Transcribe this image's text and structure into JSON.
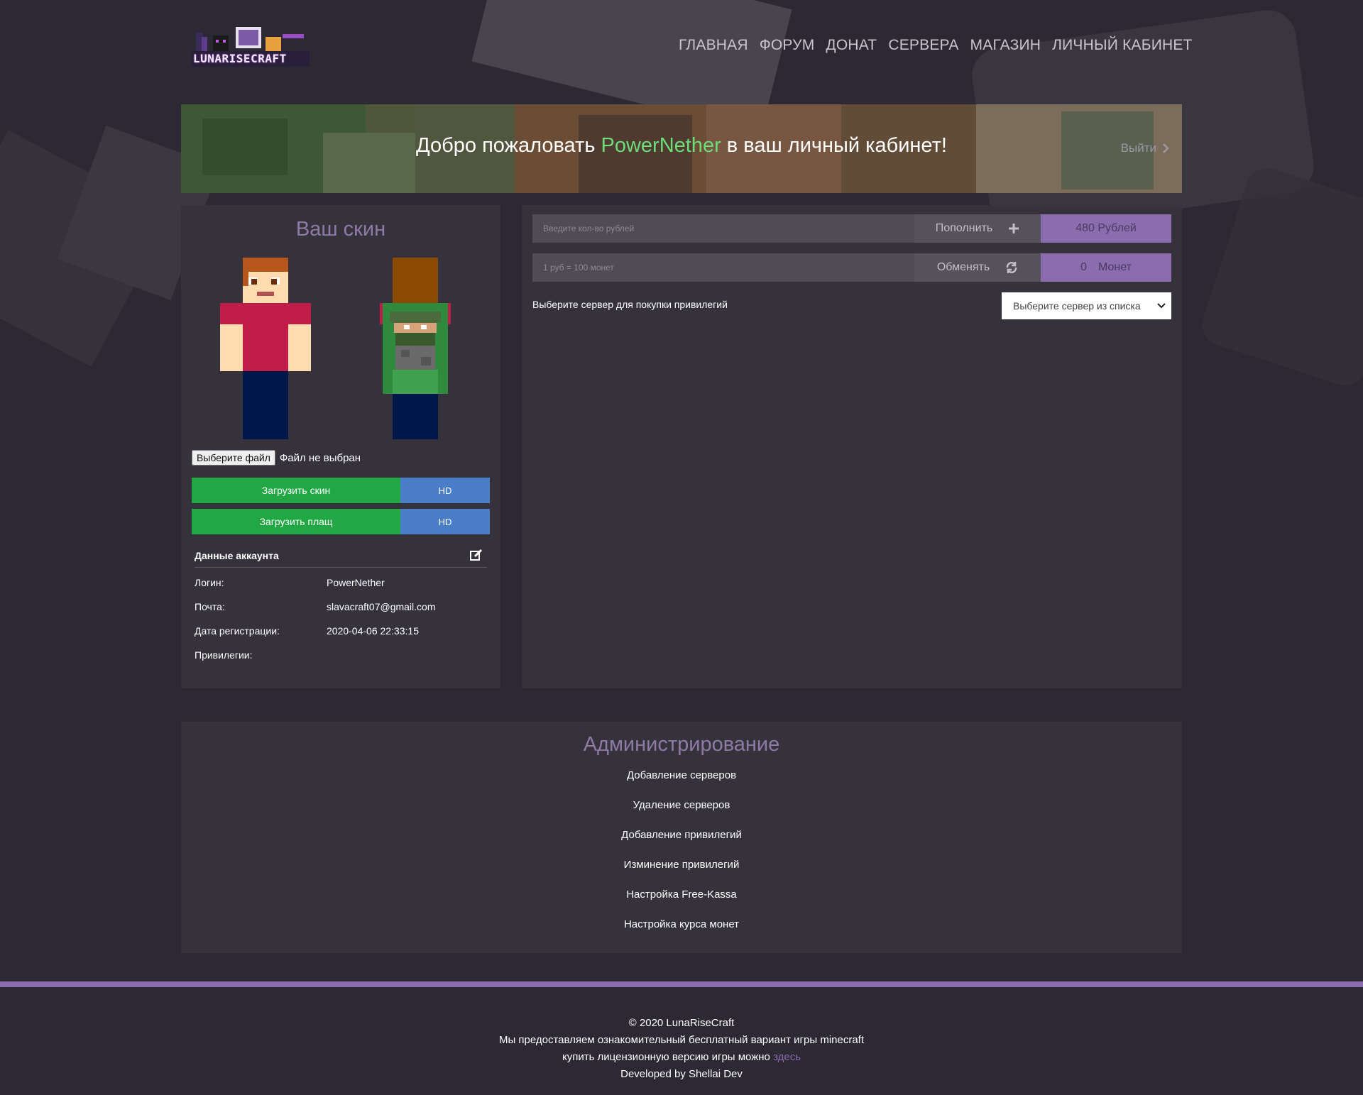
{
  "header": {
    "brand": "LUNARISECRAFT",
    "nav": [
      "ГЛАВНАЯ",
      "ФОРУМ",
      "ДОНАТ",
      "СЕРВЕРА",
      "МАГАЗИН",
      "ЛИЧНЫЙ КАБИНЕТ"
    ]
  },
  "banner": {
    "prefix": "Добро пожаловать ",
    "username": "PowerNether",
    "suffix": " в ваш личный кабинет!",
    "logout": "Выйти"
  },
  "skin": {
    "title": "Ваш скин",
    "file_button": "Выберите файл",
    "file_status": "Файл не выбран",
    "upload_skin": "Загрузить скин",
    "upload_cloak": "Загрузить плащ",
    "hd": "HD"
  },
  "account": {
    "title": "Данные аккаунта",
    "rows": [
      {
        "key": "Логин:",
        "value": "PowerNether"
      },
      {
        "key": "Почта:",
        "value": "slavacraft07@gmail.com"
      },
      {
        "key": "Дата регистрации:",
        "value": "2020-04-06 22:33:15"
      },
      {
        "key": "Привилегии:",
        "value": ""
      }
    ]
  },
  "balance": {
    "topup_placeholder": "Введите кол-во рублей",
    "topup_button": "Пополнить",
    "rubles": "480 Рублей",
    "exchange_placeholder": "1 руб = 100 монет",
    "exchange_button": "Обменять",
    "coins_amount": "0",
    "coins_label": "Монет"
  },
  "server": {
    "label": "Выберите сервер для покупки привилегий",
    "select_value": "Выберите сервер из списка"
  },
  "admin": {
    "title": "Администрирование",
    "links": [
      "Добавление серверов",
      "Удаление серверов",
      "Добавление привилегий",
      "Изминение привилегий",
      "Настройка Free-Kassa",
      "Настройка курса монет"
    ]
  },
  "footer": {
    "copyright": "© 2020 LunaRiseCraft",
    "line1": "Мы предоставляем ознакомительный бесплатный вариант игры minecraft",
    "line2": "купить лицензионную версию игры можно",
    "link": "здесь",
    "dev": "Developed by Shellai Dev"
  },
  "colors": {
    "accent": "#8a6caf",
    "green": "#22a745",
    "blue": "#4b7ec8",
    "username": "#6ddc7a"
  }
}
